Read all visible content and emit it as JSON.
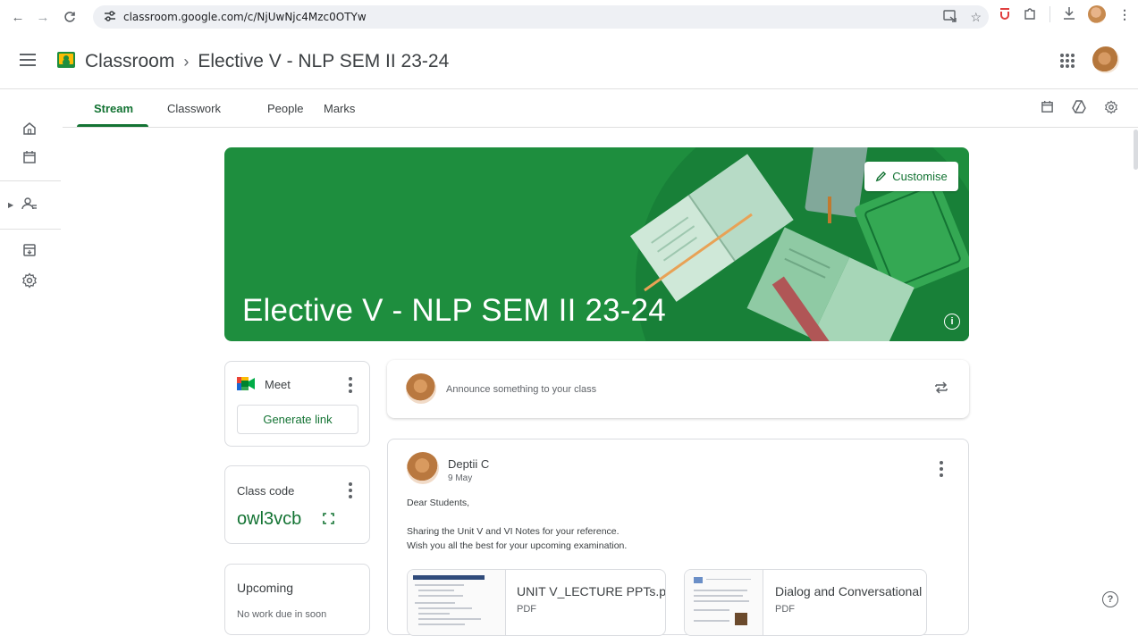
{
  "browser": {
    "url": "classroom.google.com/c/NjUwNjc4Mzc0OTYw",
    "todo_ext": "ᗜ"
  },
  "header": {
    "app_name": "Classroom",
    "breadcrumb_separator": "›",
    "class_name": "Elective V - NLP SEM II 23-24"
  },
  "tabs": [
    {
      "label": "Stream"
    },
    {
      "label": "Classwork"
    },
    {
      "label": "People"
    },
    {
      "label": "Marks"
    }
  ],
  "banner": {
    "title": "Elective V - NLP SEM II 23-24",
    "customise_label": "Customise",
    "color": "#1e8e3e"
  },
  "meet": {
    "label": "Meet",
    "button_label": "Generate link"
  },
  "class_code": {
    "label": "Class code",
    "value": "owl3vcb"
  },
  "upcoming": {
    "label": "Upcoming",
    "empty_text": "No work due in soon"
  },
  "announce": {
    "placeholder": "Announce something to your class"
  },
  "post": {
    "author": "Deptii C",
    "date": "9 May",
    "lines": [
      "Dear Students,",
      "",
      "Sharing the Unit V and VI Notes for your reference.",
      "Wish you all the best for your upcoming examination."
    ],
    "attachments": [
      {
        "title": "UNIT V_LECTURE PPTs.pdf",
        "type": "PDF"
      },
      {
        "title": "Dialog and Conversational ...",
        "type": "PDF"
      }
    ]
  },
  "colors": {
    "accent": "#137333",
    "banner": "#1e8e3e"
  }
}
